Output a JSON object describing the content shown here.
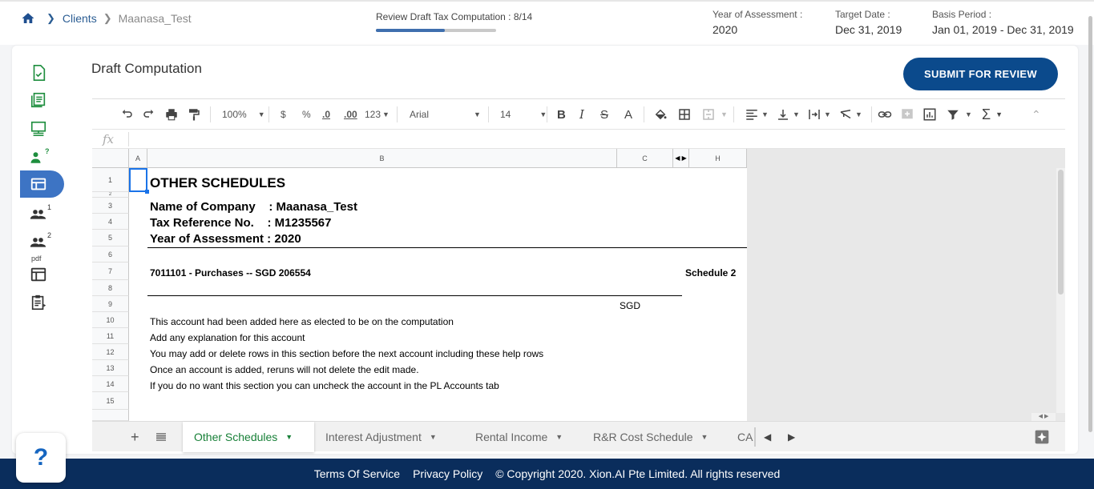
{
  "breadcrumb": {
    "link": "Clients",
    "current": "Maanasa_Test"
  },
  "progress": {
    "label": "Review Draft Tax Computation : 8/14",
    "step": 8,
    "total": 14
  },
  "meta": [
    {
      "key": "Year of Assessment :",
      "value": "2020"
    },
    {
      "key": "Target Date :",
      "value": "Dec 31, 2019"
    },
    {
      "key": "Basis Period :",
      "value": "Jan 01, 2019 - Dec 31, 2019"
    }
  ],
  "sidebar": {
    "items": [
      {
        "icon": "document-check-icon"
      },
      {
        "icon": "document-list-icon"
      },
      {
        "icon": "monitor-tree-icon"
      },
      {
        "icon": "person-question-icon",
        "sup": "?"
      },
      {
        "icon": "table-layout-icon",
        "active": true
      },
      {
        "icon": "people-icon",
        "sup": "1"
      },
      {
        "icon": "people-icon",
        "sup": "2"
      },
      {
        "icon": "pdf-layout-icon",
        "tag": "pdf"
      },
      {
        "icon": "clipboard-icon"
      }
    ]
  },
  "page": {
    "title": "Draft Computation",
    "submit_label": "SUBMIT FOR REVIEW"
  },
  "toolbar": {
    "zoom": "100%",
    "currency": "$",
    "percent": "%",
    "dec_less": ".0",
    "dec_more": ".00",
    "format": "123",
    "font": "Arial",
    "size": "14",
    "fx": "fx"
  },
  "grid": {
    "columns": [
      "A",
      "B",
      "C",
      "H"
    ],
    "rows": [
      "1",
      "2",
      "3",
      "4",
      "5",
      "6",
      "7",
      "8",
      "9",
      "10",
      "11",
      "12",
      "13",
      "14",
      "15"
    ],
    "heading": "OTHER SCHEDULES",
    "company": "Name of Company    : Maanasa_Test",
    "taxref": "Tax Reference No.    : M1235567",
    "ya": "Year of Assessment : 2020",
    "account": "7011101 - Purchases -- SGD 206554",
    "schedule": "Schedule 2",
    "currency": "SGD",
    "notes": [
      "This account had been added here as elected to be on the computation",
      "Add any explanation for this account",
      "You may add or delete rows in this section before the next account including these help rows",
      "Once an account is added, reruns will not delete the edit made.",
      "If you do no want this section you can uncheck the account in the PL Accounts tab"
    ]
  },
  "tabs": [
    "Other Schedules",
    "Interest Adjustment",
    "Rental Income",
    "R&R Cost Schedule",
    "CA"
  ],
  "help": {
    "label": "?"
  },
  "footer": {
    "terms": "Terms Of Service",
    "privacy": "Privacy Policy",
    "copyright": "© Copyright 2020. Xion.AI Pte Limited. All rights reserved"
  },
  "colors": {
    "primary": "#0b4a8c",
    "active_side": "#3d74c4",
    "footer": "#0a2d5c",
    "sheet_green": "#188038",
    "side_icon": "#1e8e3e"
  }
}
